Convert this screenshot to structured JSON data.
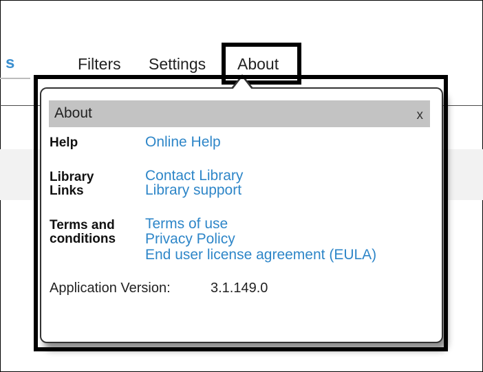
{
  "tabs": {
    "partial": "s",
    "filters": "Filters",
    "settings": "Settings",
    "about": "About"
  },
  "popover": {
    "title": "About",
    "close": "x",
    "help": {
      "label": "Help",
      "links": [
        "Online Help"
      ]
    },
    "library": {
      "label_line1": "Library",
      "label_line2": "Links",
      "links": [
        "Contact Library",
        "Library support"
      ]
    },
    "terms": {
      "label_line1": "Terms and",
      "label_line2": "conditions",
      "links": [
        "Terms of use",
        "Privacy Policy",
        "End user license agreement (EULA)"
      ]
    },
    "version": {
      "label": "Application Version:",
      "value": "3.1.149.0"
    }
  },
  "colors": {
    "link": "#2e86c8",
    "header_bg": "#c3c3c3",
    "tab_accent": "#3a8fd0"
  }
}
